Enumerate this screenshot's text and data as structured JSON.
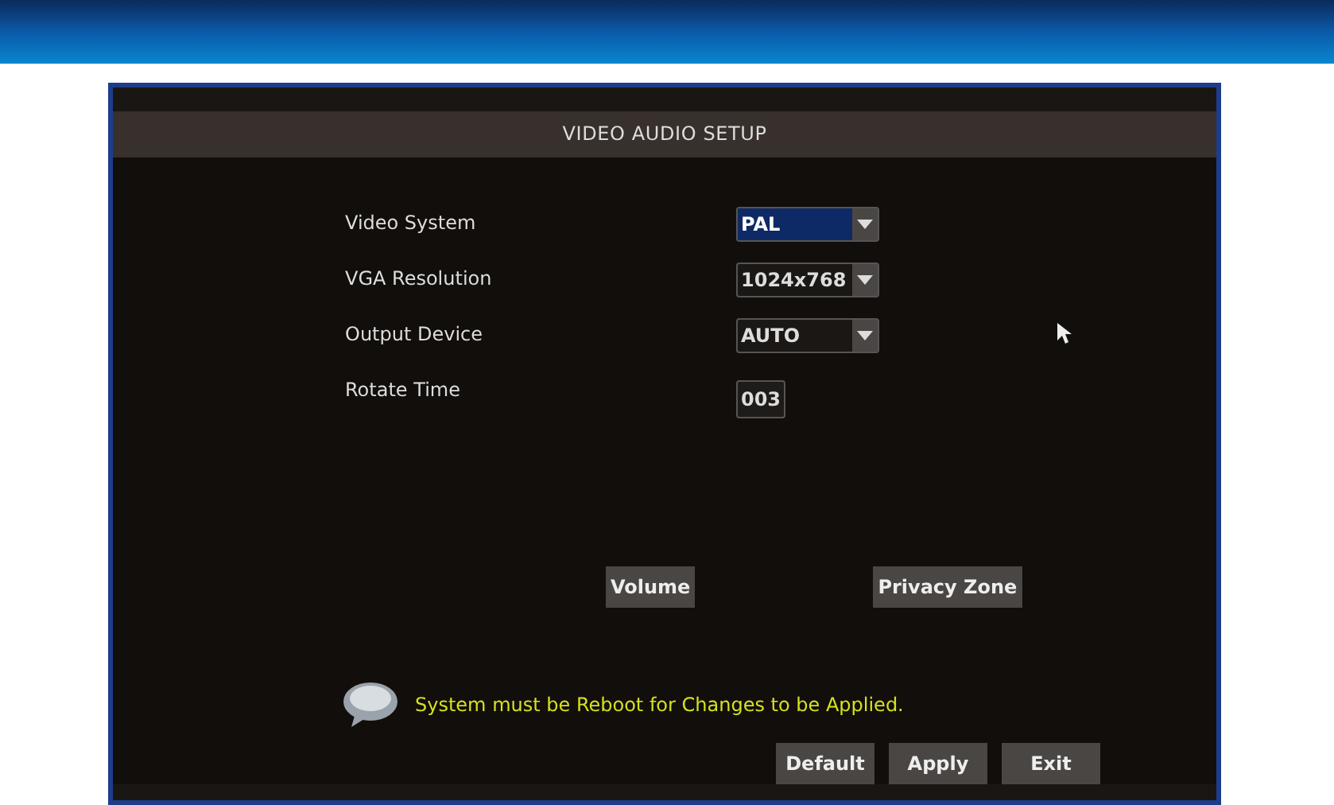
{
  "window": {
    "title": "VIDEO AUDIO SETUP"
  },
  "settings": [
    {
      "label": "Video System",
      "kind": "dropdown",
      "value": "PAL",
      "selected": true
    },
    {
      "label": "VGA Resolution",
      "kind": "dropdown",
      "value": "1024x768",
      "selected": false
    },
    {
      "label": "Output Device",
      "kind": "dropdown",
      "value": "AUTO",
      "selected": false
    },
    {
      "label": "Rotate Time",
      "kind": "number",
      "value": "003",
      "selected": false
    }
  ],
  "sub_buttons": [
    "Volume",
    "Privacy Zone"
  ],
  "notice": "System must be Reboot for Changes to be Applied.",
  "buttons": [
    "Default",
    "Apply",
    "Exit"
  ]
}
